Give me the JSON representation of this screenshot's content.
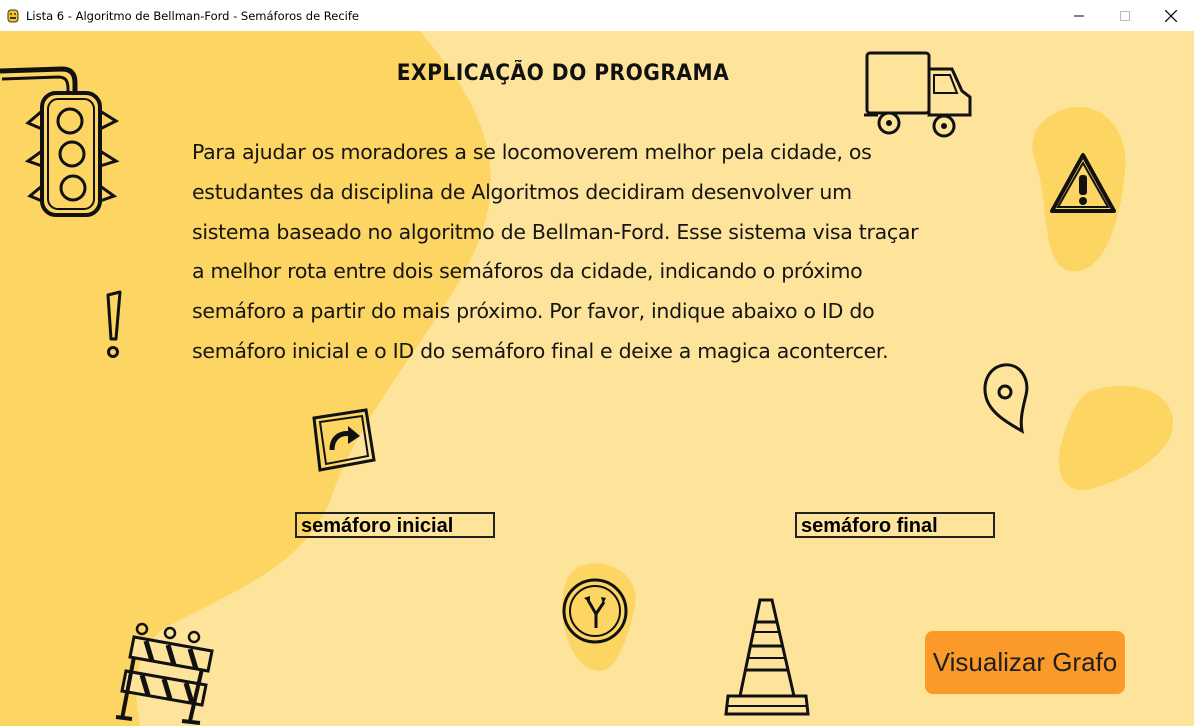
{
  "window": {
    "title": "Lista 6 - Algoritmo de Bellman-Ford - Semáforos de Recife",
    "app_icon": "python-icon",
    "controls": [
      "minimize-icon",
      "maximize-icon",
      "close-icon"
    ]
  },
  "main": {
    "heading": "EXPLICAÇÃO DO PROGRAMA",
    "paragraph_lines": [
      "Para ajudar os moradores a se locomoverem melhor pela cidade, os",
      "estudantes da disciplina de Algoritmos decidiram desenvolver um",
      "sistema baseado no algoritmo de Bellman-Ford. Esse sistema visa traçar",
      "a melhor rota entre dois semáforos da cidade, indicando o próximo",
      "semáforo a partir do mais próximo. Por favor, indique abaixo o ID do",
      "semáforo inicial e o ID do semáforo final e deixe a magica acontercer."
    ]
  },
  "inputs": {
    "start": {
      "placeholder": "semáforo inicial"
    },
    "end": {
      "placeholder": "semáforo final"
    }
  },
  "actions": {
    "visualize_label": "Visualizar Grafo"
  },
  "decorations": [
    "traffic-light-icon",
    "truck-icon",
    "warning-sign-icon",
    "exclamation-icon",
    "location-pin-icon",
    "turn-sign-icon",
    "fork-road-sign-icon",
    "barrier-icon",
    "traffic-cone-icon"
  ],
  "colors": {
    "background": "#fee49b",
    "blob": "#fdd562",
    "button": "#fb9a28"
  }
}
